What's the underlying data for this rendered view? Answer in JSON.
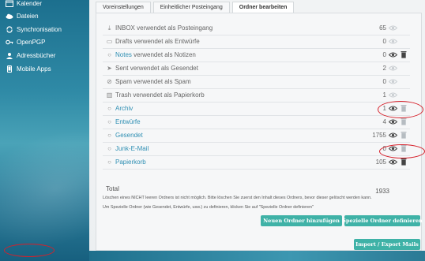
{
  "sidebar": {
    "items": [
      {
        "label": "Kalender",
        "icon": "calendar-icon"
      },
      {
        "label": "Dateien",
        "icon": "cloud-icon"
      },
      {
        "label": "Synchronisation",
        "icon": "sync-icon"
      },
      {
        "label": "OpenPGP",
        "icon": "key-icon"
      },
      {
        "label": "Adressbücher",
        "icon": "contacts-icon"
      },
      {
        "label": "Mobile Apps",
        "icon": "mobile-icon"
      }
    ]
  },
  "tabs": [
    {
      "label": "Voreinstellungen",
      "active": false
    },
    {
      "label": "Einheitlicher Posteingang",
      "active": false
    },
    {
      "label": "Ordner bearbeiten",
      "active": true
    }
  ],
  "folders": [
    {
      "icon": "download-icon",
      "name": "INBOX",
      "suffix": " verwendet als Posteingang",
      "link": false,
      "count": "65"
    },
    {
      "icon": "draft-icon",
      "name": "Drafts",
      "suffix": " verwendet als Entwürfe",
      "link": false,
      "count": "0"
    },
    {
      "icon": "folder-icon",
      "name": "Notes",
      "suffix": " verwendet als Notizen",
      "link": true,
      "count": "0"
    },
    {
      "icon": "send-icon",
      "name": "Sent",
      "suffix": " verwendet als Gesendet",
      "link": false,
      "count": "2"
    },
    {
      "icon": "spam-icon",
      "name": "Spam",
      "suffix": " verwendet als Spam",
      "link": false,
      "count": "0"
    },
    {
      "icon": "trash-folder-icon",
      "name": "Trash",
      "suffix": " verwendet als Papierkorb",
      "link": false,
      "count": "1"
    },
    {
      "icon": "folder-icon",
      "name": "Archiv",
      "suffix": "",
      "link": true,
      "count": "1"
    },
    {
      "icon": "folder-icon",
      "name": "Entwürfe",
      "suffix": "",
      "link": true,
      "count": "4"
    },
    {
      "icon": "folder-icon",
      "name": "Gesendet",
      "suffix": "",
      "link": true,
      "count": "1755"
    },
    {
      "icon": "folder-icon",
      "name": "Junk-E-Mail",
      "suffix": "",
      "link": true,
      "count": "0"
    },
    {
      "icon": "folder-icon",
      "name": "Papierkorb",
      "suffix": "",
      "link": true,
      "count": "105"
    }
  ],
  "total": {
    "label": "Total",
    "value": "1933"
  },
  "notes": [
    "Löschen eines NICHT leeren Ordners ist nicht möglich. Bitte löschen Sie zuerst den Inhalt dieses Ordners, bevor dieser gelöscht werden kann.",
    "Um Spezielle Ordner (wie Gesendet, Entwürfe, usw.) zu definieren, klicken Sie auf \"Spezielle Ordner definieren\""
  ],
  "buttons": {
    "new_folder": "Neuen Ordner hinzufügen",
    "special_folders": "Spezielle Ordner definieren",
    "import_export": "Import / Export Mails"
  },
  "colors": {
    "accent": "#3fb2a7",
    "link": "#2f8fb3",
    "annotation": "#d6202a",
    "sidebar": "#2b7d9a"
  }
}
